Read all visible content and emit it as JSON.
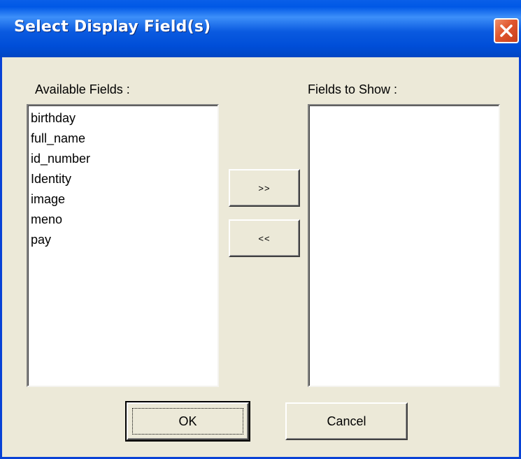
{
  "window": {
    "title": "Select Display Field(s)"
  },
  "available": {
    "label": "Available Fields :",
    "items": [
      "birthday",
      "full_name",
      "id_number",
      "Identity",
      "image",
      "meno",
      "pay"
    ]
  },
  "selected": {
    "label": "Fields to Show :",
    "items": []
  },
  "buttons": {
    "add": ">>",
    "remove": "<<",
    "ok": "OK",
    "cancel": "Cancel"
  },
  "icons": {
    "close": "close-icon"
  },
  "colors": {
    "titlebar": "#0058e6",
    "dialog_bg": "#ece9d8",
    "close_button": "#e0562e",
    "list_bg": "#ffffff"
  }
}
